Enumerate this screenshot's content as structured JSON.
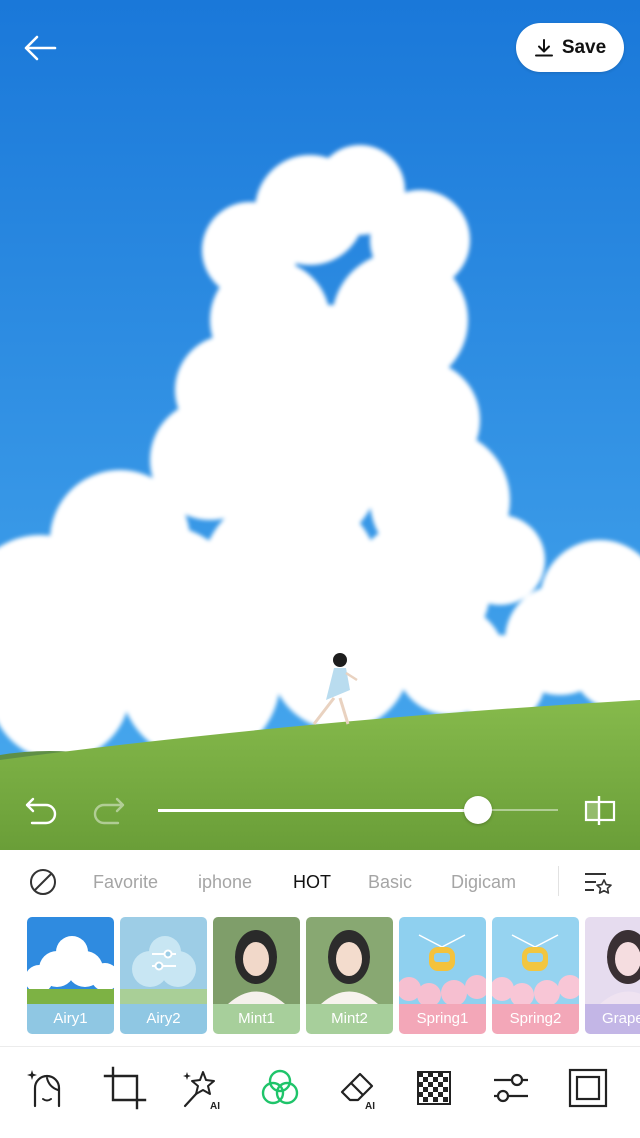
{
  "header": {
    "back_icon": "arrow-left-icon",
    "save_label": "Save",
    "save_icon": "download-icon"
  },
  "editor": {
    "undo_icon": "undo-icon",
    "redo_icon": "redo-icon",
    "intensity_percent": 80,
    "compare_icon": "compare-icon"
  },
  "tabs": [
    {
      "label": "Favorite",
      "active": false
    },
    {
      "label": "iphone",
      "active": false
    },
    {
      "label": "HOT",
      "active": true
    },
    {
      "label": "Basic",
      "active": false
    },
    {
      "label": "Digicam",
      "active": false
    }
  ],
  "filters": [
    {
      "label": "Airy1",
      "color": "#8fc7e3",
      "thumb": "sky"
    },
    {
      "label": "Airy2",
      "color": "#8fc7e3",
      "thumb": "sky-adjust"
    },
    {
      "label": "Mint1",
      "color": "#a7cf9b",
      "thumb": "portrait"
    },
    {
      "label": "Mint2",
      "color": "#a7cf9b",
      "thumb": "portrait"
    },
    {
      "label": "Spring1",
      "color": "#f3a7b8",
      "thumb": "ferris"
    },
    {
      "label": "Spring2",
      "color": "#f3a7b8",
      "thumb": "ferris"
    },
    {
      "label": "Grape",
      "color": "#c3b6e6",
      "thumb": "portrait-purple"
    }
  ],
  "tools": [
    {
      "icon": "face-retouch-icon",
      "active": false
    },
    {
      "icon": "crop-icon",
      "active": false
    },
    {
      "icon": "ai-magic-wand-icon",
      "active": false
    },
    {
      "icon": "filter-icon",
      "active": true
    },
    {
      "icon": "ai-eraser-icon",
      "active": false
    },
    {
      "icon": "mosaic-icon",
      "active": false
    },
    {
      "icon": "adjust-icon",
      "active": false
    },
    {
      "icon": "frame-icon",
      "active": false
    }
  ],
  "colors": {
    "sky_top": "#1a78d9",
    "sky_bottom": "#3aa3ee",
    "grass": "#7db244",
    "active_tool": "#1fc46a"
  }
}
